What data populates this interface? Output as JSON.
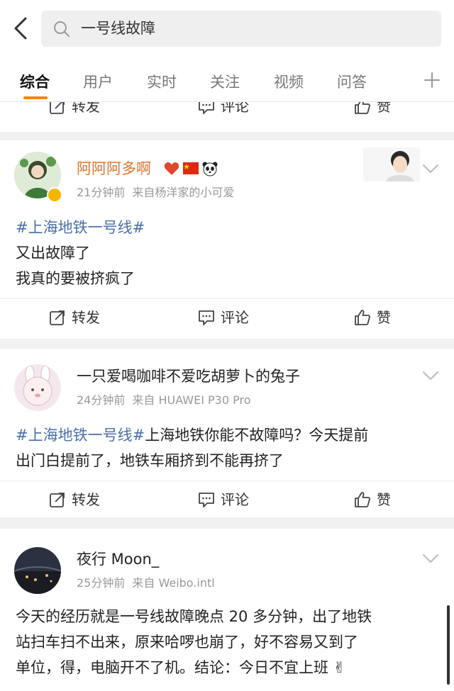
{
  "search": {
    "query": "一号线故障"
  },
  "tabs": [
    {
      "label": "综合"
    },
    {
      "label": "用户"
    },
    {
      "label": "实时"
    },
    {
      "label": "关注"
    },
    {
      "label": "视频"
    },
    {
      "label": "问答"
    }
  ],
  "actions": {
    "repost": "转发",
    "comment": "评论",
    "like": "赞"
  },
  "posts": [
    {
      "author": "阿阿阿多啊",
      "time": "21分钟前",
      "source": "来自杨洋家的小可爱",
      "hashtag": "#上海地铁一号线#",
      "text_lines": [
        "又出故障了",
        "我真的要被挤疯了"
      ]
    },
    {
      "author": "一只爱喝咖啡不爱吃胡萝卜的兔子",
      "time": "24分钟前",
      "source": "来自 HUAWEI P30 Pro",
      "hashtag": "#上海地铁一号线#",
      "text_first": "上海地铁你能不故障吗？今天提前",
      "text_lines": [
        "出门白提前了，地铁车厢挤到不能再挤了"
      ]
    },
    {
      "author": "夜行 Moon_",
      "time": "25分钟前",
      "source": "来自 Weibo.intl",
      "text_lines": [
        "今天的经历就是一号线故障晚点 20 多分钟，出了地铁",
        "站扫车扫不出来，原来哈啰也崩了，好不容易又到了",
        "单位，得，电脑开不了机。结论：今日不宜上班 ✌"
      ]
    }
  ],
  "colors": {
    "accent": "#ff8200",
    "hashtag": "#4a6fa8",
    "author_orange": "#e2712a"
  }
}
